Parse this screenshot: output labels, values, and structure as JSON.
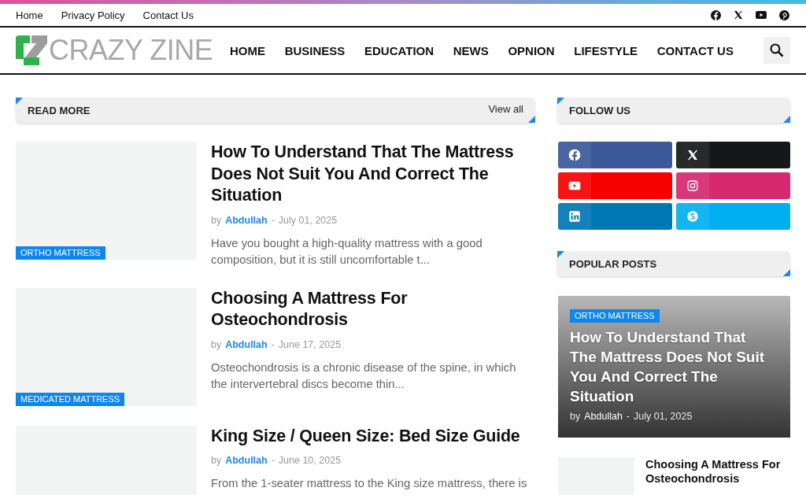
{
  "top_links": [
    "Home",
    "Privacy Policy",
    "Contact Us"
  ],
  "logo": {
    "text": "CRAZY ZINE"
  },
  "nav": [
    "HOME",
    "BUSINESS",
    "EDUCATION",
    "NEWS",
    "OPNION",
    "LIFESTYLE",
    "CONTACT US"
  ],
  "read_more": {
    "title": "READ MORE",
    "link": "View all",
    "articles": [
      {
        "category": "ORTHO MATTRESS",
        "title": "How To Understand That The Mattress Does Not Suit You And Correct The Situation",
        "by": "by",
        "author": "Abdullah",
        "sep": "-",
        "date": "July 01, 2025",
        "excerpt": "Have you bought a high-quality mattress with a good composition, but it is still uncomfortable t..."
      },
      {
        "category": "MEDICATED MATTRESS",
        "title": "Choosing A Mattress For Osteochondrosis",
        "by": "by",
        "author": "Abdullah",
        "sep": "-",
        "date": "June 17, 2025",
        "excerpt": "Osteochondrosis is a chronic disease of the spine, in which the intervertebral discs become thin..."
      },
      {
        "title": "King Size / Queen Size: Bed Size Guide",
        "by": "by",
        "author": "Abdullah",
        "sep": "-",
        "date": "June 10, 2025",
        "excerpt": "From the 1-seater mattress to the King size mattress, there is"
      }
    ]
  },
  "follow_us": {
    "title": "FOLLOW US",
    "buttons": [
      {
        "kind": "facebook",
        "color": "#3b5998"
      },
      {
        "kind": "x",
        "color": "#15171a"
      },
      {
        "kind": "youtube",
        "color": "#f70000"
      },
      {
        "kind": "instagram",
        "color": "#d6296f"
      },
      {
        "kind": "linkedin",
        "color": "#0077b5"
      },
      {
        "kind": "skype",
        "color": "#00aff0"
      }
    ]
  },
  "popular_posts": {
    "title": "POPULAR POSTS",
    "featured": {
      "category": "ORTHO MATTRESS",
      "title": "How To Understand That The Mattress Does Not Suit You And Correct The Situation",
      "by": "by",
      "author": "Abdullah",
      "sep": "-",
      "date": "July 01, 2025"
    },
    "items": [
      {
        "title": "Choosing A Mattress For Osteochondrosis"
      }
    ]
  }
}
